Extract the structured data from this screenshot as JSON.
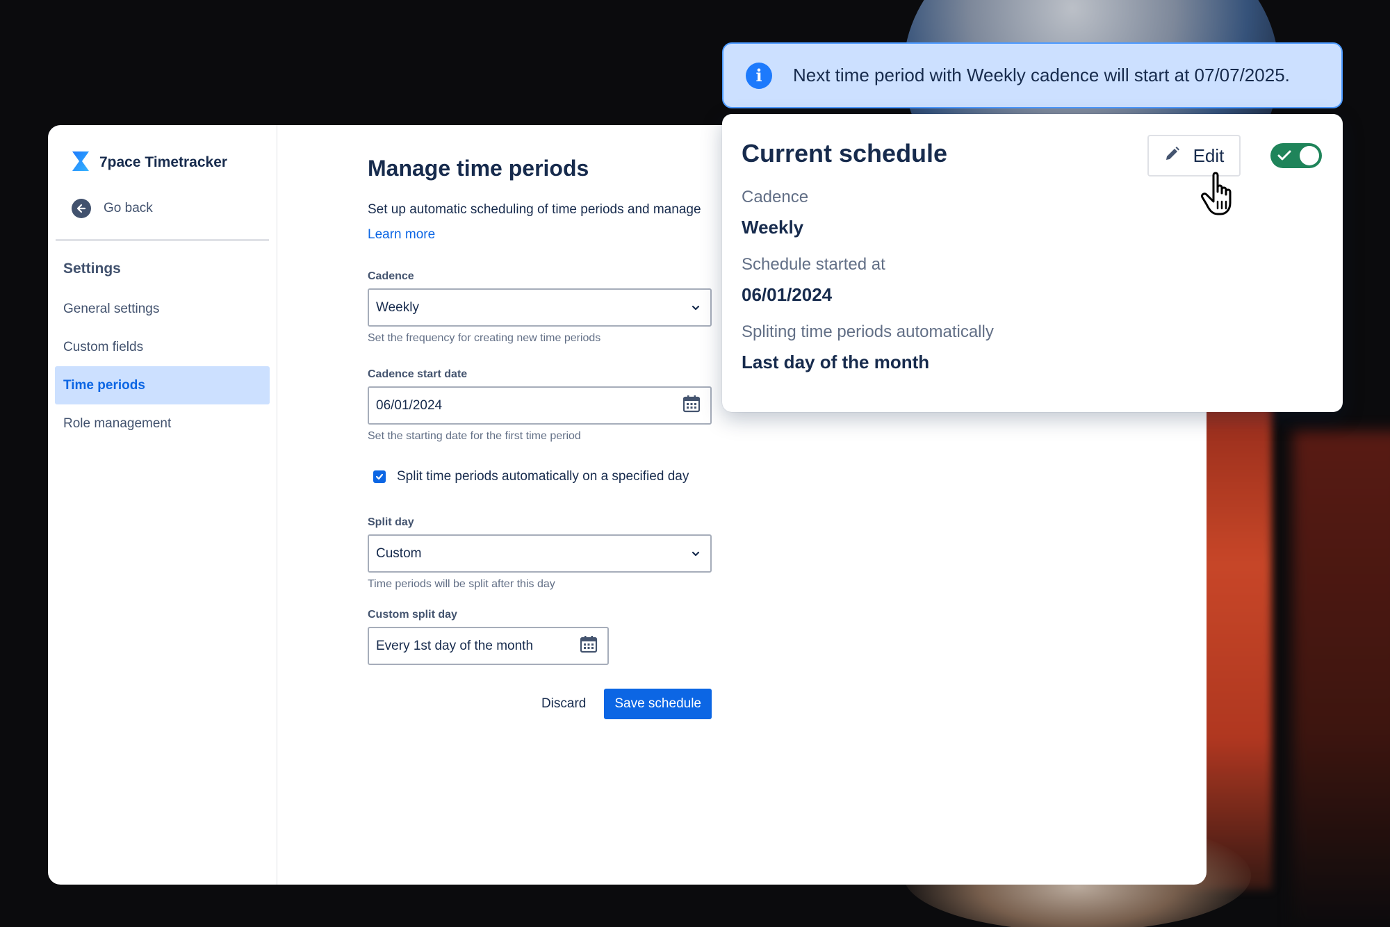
{
  "app": {
    "title": "7pace Timetracker"
  },
  "sidebar": {
    "go_back": "Go back",
    "heading": "Settings",
    "items": [
      {
        "label": "General settings",
        "active": false
      },
      {
        "label": "Custom fields",
        "active": false
      },
      {
        "label": "Time periods",
        "active": true
      },
      {
        "label": "Role management",
        "active": false
      }
    ]
  },
  "main": {
    "title": "Manage time periods",
    "description": "Set up automatic scheduling of time periods and manage",
    "learn_more": "Learn more",
    "cadence": {
      "label": "Cadence",
      "value": "Weekly",
      "help": "Set the frequency for creating new time periods"
    },
    "cadence_start": {
      "label": "Cadence start date",
      "value": "06/01/2024",
      "help": "Set the starting date for the first time period"
    },
    "split_checkbox": {
      "label": "Split time periods automatically on a specified day",
      "checked": true
    },
    "split_day": {
      "label": "Split day",
      "value": "Custom",
      "help": "Time periods will be split after this day"
    },
    "custom_split_day": {
      "label": "Custom split day",
      "value": "Every 1st day of the month"
    },
    "actions": {
      "discard": "Discard",
      "save": "Save schedule"
    }
  },
  "banner": {
    "text": "Next time period with Weekly cadence will start at 07/07/2025.",
    "icon": "info-icon"
  },
  "schedule_card": {
    "title": "Current schedule",
    "edit_label": "Edit",
    "toggle_on": true,
    "fields": [
      {
        "label": "Cadence",
        "value": "Weekly"
      },
      {
        "label": "Schedule started at",
        "value": "06/01/2024"
      },
      {
        "label": "Spliting time periods automatically",
        "value": "Last day of the month"
      }
    ]
  },
  "colors": {
    "brand_blue": "#0c66e4",
    "active_nav_bg": "#cce0ff",
    "toggle_green": "#1f845a",
    "banner_bg": "#cce0ff"
  }
}
